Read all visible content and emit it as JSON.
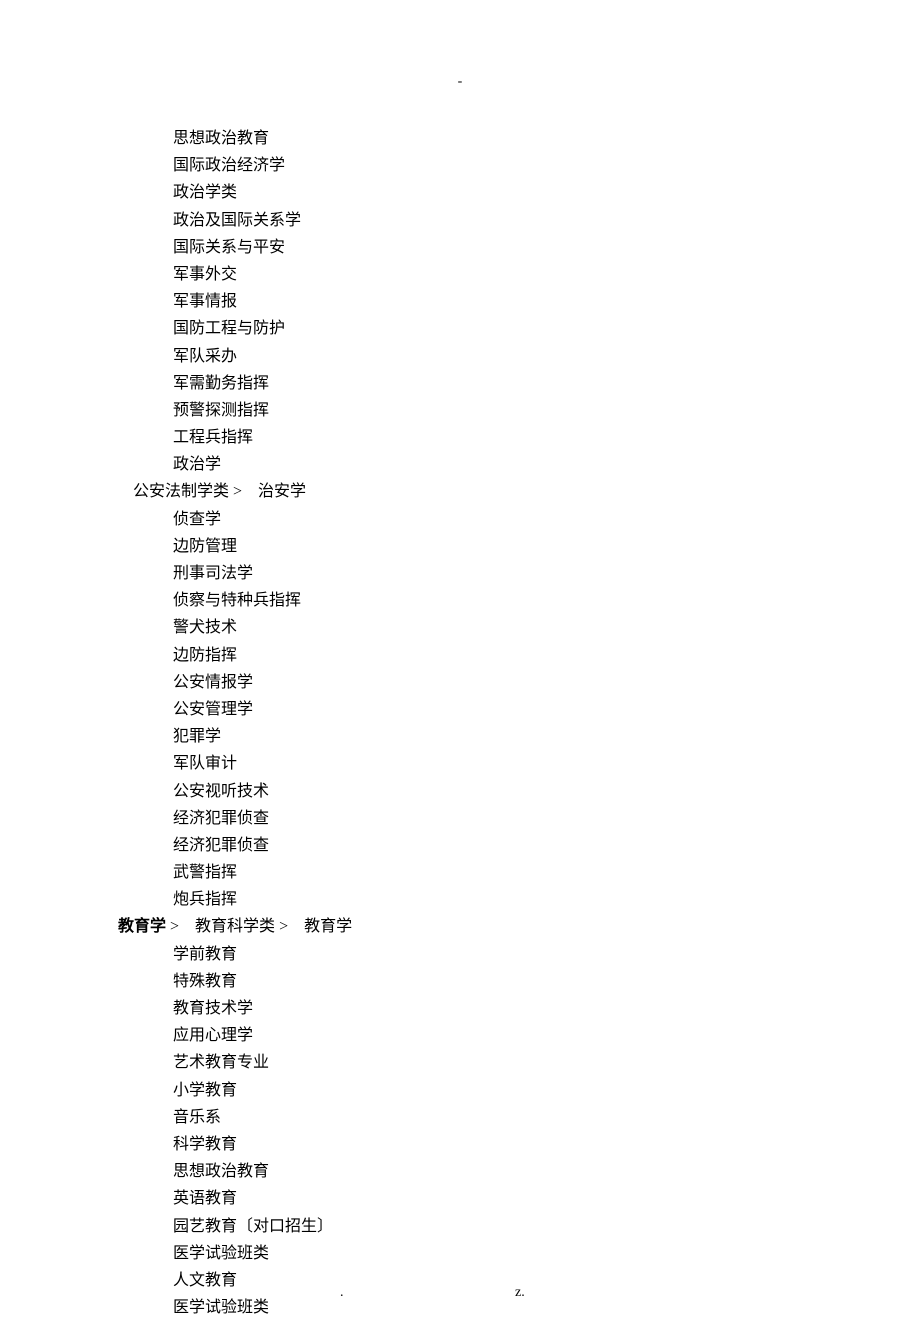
{
  "header_mark": "-",
  "footer_left": ".",
  "footer_right": "z.",
  "sections": [
    {
      "indent": "item",
      "text": "思想政治教育"
    },
    {
      "indent": "item",
      "text": "国际政治经济学"
    },
    {
      "indent": "item",
      "text": "政治学类"
    },
    {
      "indent": "item",
      "text": "政治及国际关系学"
    },
    {
      "indent": "item",
      "text": "国际关系与平安"
    },
    {
      "indent": "item",
      "text": "军事外交"
    },
    {
      "indent": "item",
      "text": "军事情报"
    },
    {
      "indent": "item",
      "text": "国防工程与防护"
    },
    {
      "indent": "item",
      "text": "军队采办"
    },
    {
      "indent": "item",
      "text": "军需勤务指挥"
    },
    {
      "indent": "item",
      "text": "预警探测指挥"
    },
    {
      "indent": "item",
      "text": "工程兵指挥"
    },
    {
      "indent": "item",
      "text": "政治学"
    },
    {
      "indent": "category",
      "category": "公安法制学类",
      "first_item": "治安学"
    },
    {
      "indent": "item",
      "text": "侦查学"
    },
    {
      "indent": "item",
      "text": "边防管理"
    },
    {
      "indent": "item",
      "text": "刑事司法学"
    },
    {
      "indent": "item",
      "text": "侦察与特种兵指挥"
    },
    {
      "indent": "item",
      "text": "警犬技术"
    },
    {
      "indent": "item",
      "text": "边防指挥"
    },
    {
      "indent": "item",
      "text": "公安情报学"
    },
    {
      "indent": "item",
      "text": "公安管理学"
    },
    {
      "indent": "item",
      "text": "犯罪学"
    },
    {
      "indent": "item",
      "text": "军队审计"
    },
    {
      "indent": "item",
      "text": "公安视听技术"
    },
    {
      "indent": "item",
      "text": "经济犯罪侦查"
    },
    {
      "indent": "item",
      "text": "经济犯罪侦查"
    },
    {
      "indent": "item",
      "text": "武警指挥"
    },
    {
      "indent": "item",
      "text": "炮兵指挥"
    },
    {
      "indent": "discipline",
      "discipline": "教育学",
      "category": "教育科学类",
      "first_item": "教育学"
    },
    {
      "indent": "item",
      "text": "学前教育"
    },
    {
      "indent": "item",
      "text": "特殊教育"
    },
    {
      "indent": "item",
      "text": "教育技术学"
    },
    {
      "indent": "item",
      "text": "应用心理学"
    },
    {
      "indent": "item",
      "text": "艺术教育专业"
    },
    {
      "indent": "item",
      "text": "小学教育"
    },
    {
      "indent": "item",
      "text": "音乐系"
    },
    {
      "indent": "item",
      "text": "科学教育"
    },
    {
      "indent": "item",
      "text": "思想政治教育"
    },
    {
      "indent": "item",
      "text": "英语教育"
    },
    {
      "indent": "item",
      "text": "园艺教育〔对口招生〕"
    },
    {
      "indent": "item",
      "text": "医学试验班类"
    },
    {
      "indent": "item",
      "text": "人文教育"
    },
    {
      "indent": "item",
      "text": "医学试验班类"
    }
  ]
}
